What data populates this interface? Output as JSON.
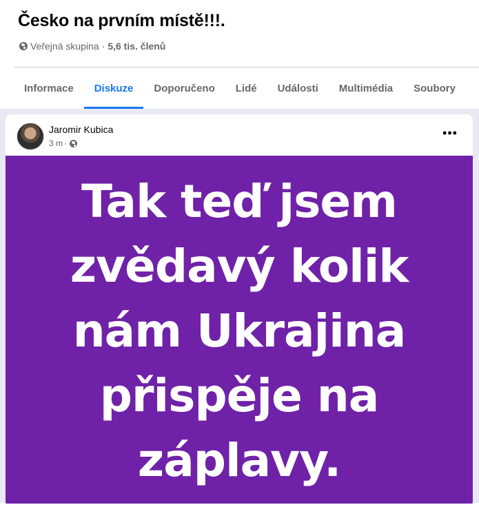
{
  "group": {
    "title": "Česko na prvním místě!!!.",
    "privacy": "Veřejná skupina",
    "separator": "·",
    "members": "5,6 tis. členů"
  },
  "tabs": [
    {
      "label": "Informace",
      "active": false
    },
    {
      "label": "Diskuze",
      "active": true
    },
    {
      "label": "Doporučeno",
      "active": false
    },
    {
      "label": "Lidé",
      "active": false
    },
    {
      "label": "Události",
      "active": false
    },
    {
      "label": "Multimédia",
      "active": false
    },
    {
      "label": "Soubory",
      "active": false
    }
  ],
  "post": {
    "author": "Jaromir Kubica",
    "time": "3 m",
    "separator": "·",
    "more_icon": "•••",
    "image_lines": [
      "Tak teď jsem",
      "zvědavý kolik",
      "nám Ukrajina",
      "přispěje na",
      "záplavy."
    ],
    "image_bg": "#6f22a8"
  },
  "colors": {
    "accent": "#1877f2",
    "muted": "#65676b",
    "feed_bg": "#e9e9f3"
  }
}
